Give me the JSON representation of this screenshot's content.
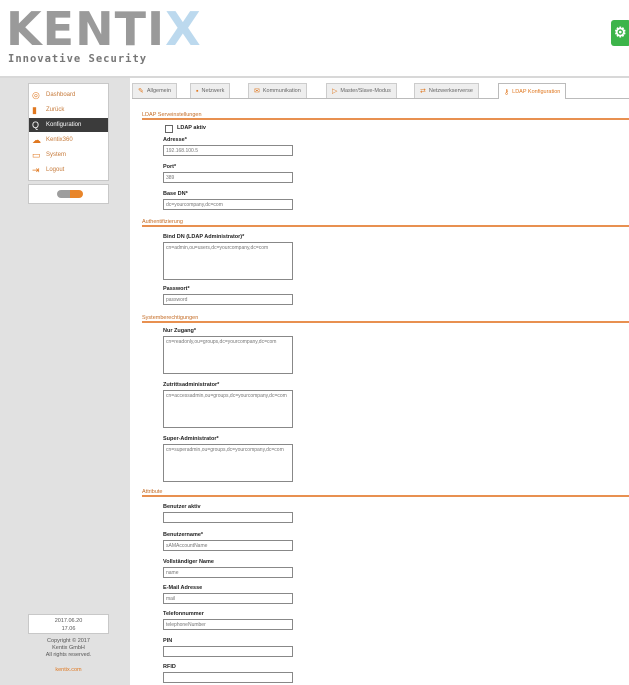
{
  "brand": {
    "logo_main": "KENTI",
    "logo_x": "X",
    "tagline": "Innovative Security"
  },
  "sidebar": {
    "items": [
      {
        "label": "Dashboard",
        "icon": "dashboard-icon"
      },
      {
        "label": "Zurück",
        "icon": "back-icon"
      },
      {
        "label": "Konfiguration",
        "icon": "search-icon",
        "active": true
      },
      {
        "label": "Kentix360",
        "icon": "cloud-icon"
      },
      {
        "label": "System",
        "icon": "monitor-icon"
      },
      {
        "label": "Logout",
        "icon": "logout-icon"
      }
    ],
    "version": "2017.06.20",
    "version2": "17.06",
    "copyright1": "Copyright © 2017",
    "copyright2": "Kentix GmbH",
    "copyright3": "All rights reserved.",
    "link": "kentix.com"
  },
  "tabs": [
    {
      "label": "Allgemein",
      "icon": "wrench-icon"
    },
    {
      "label": "Netzwerk",
      "icon": "network-icon"
    },
    {
      "label": "Kommunikation",
      "icon": "mail-icon"
    },
    {
      "label": "Master/Slave-Modus",
      "icon": "arrow-icon"
    },
    {
      "label": "Netzwerkserverse",
      "icon": "arrows-icon"
    },
    {
      "label": "LDAP Konfiguration",
      "icon": "key-icon",
      "active": true
    }
  ],
  "form": {
    "ldap_section": "LDAP Serveinstellungen",
    "ldap_active": "LDAP aktiv",
    "address_label": "Adresse*",
    "address_value": "192.168.100.5",
    "port_label": "Port*",
    "port_value": "389",
    "basedn_label": "Base DN*",
    "basedn_value": "dc=yourcompany,dc=com",
    "auth_section": "Authentifizierung",
    "binddn_label": "Bind DN (LDAP Administrator)*",
    "binddn_value": "cn=admin,ou=users,dc=yourcompany,dc=com",
    "password_label": "Passwort*",
    "password_value": "password",
    "roles_section": "Systemberechtigungen",
    "readonly_label": "Nur Zugang*",
    "readonly_value": "cn=readonly,ou=groups,dc=yourcompany,dc=com",
    "access_admin_label": "Zutrittsadministrator*",
    "access_admin_value": "cn=accessadmin,ou=groups,dc=yourcompany,dc=com",
    "superadmin_label": "Super-Administrator*",
    "superadmin_value": "cn=superadmin,ou=groups,dc=yourcompany,dc=com",
    "attr_section": "Attribute",
    "user_active_label": "Benutzer aktiv",
    "user_active_value": "",
    "username_label": "Benutzername*",
    "username_value": "sAMAccountName",
    "fullname_label": "Vollständiger Name",
    "fullname_value": "name",
    "email_label": "E-Mail Adresse",
    "email_value": "mail",
    "phone_label": "Telefonnummer",
    "phone_value": "telephoneNumber",
    "pin_label": "PIN",
    "pin_value": "",
    "rfid_label": "RFID",
    "rfid_value": ""
  },
  "colors": {
    "accent": "#e07820",
    "sidebar_bg": "#e1e1e1",
    "active_nav": "#3b3b3b",
    "share": "#3cb44a"
  }
}
